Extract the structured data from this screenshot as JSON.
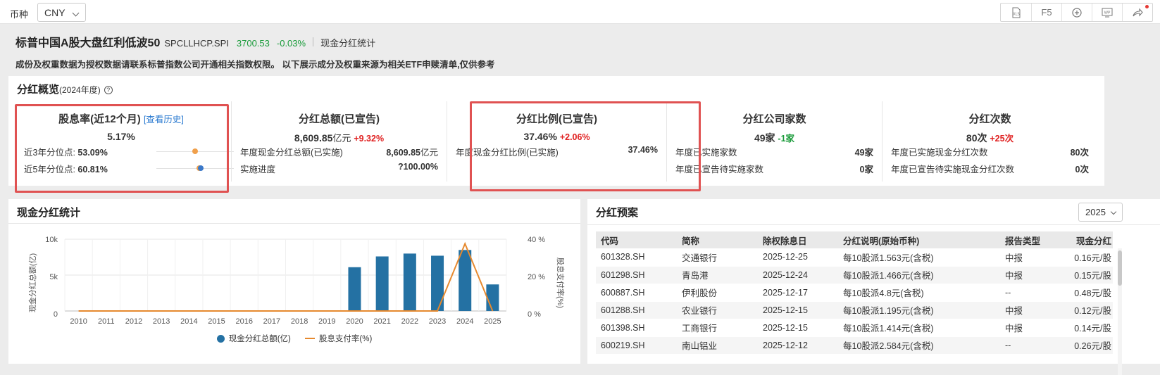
{
  "toolbar": {
    "currency_label": "币种",
    "currency_value": "CNY",
    "buttons": [
      {
        "icon": "xls-export-icon",
        "label": "XLS"
      },
      {
        "icon": "f5-refresh",
        "label": "F5"
      },
      {
        "icon": "add-circle-icon",
        "label": "⊕"
      },
      {
        "icon": "wp-export-icon",
        "label": "WP"
      },
      {
        "icon": "share-icon",
        "label": "↪"
      }
    ],
    "notification_color": "#e53935"
  },
  "header": {
    "index_name": "标普中国A股大盘红利低波50",
    "index_code": "SPCLLHCP.SPI",
    "price": "3700.53",
    "change": "-0.03%",
    "tab": "现金分红统计",
    "notice": "成份及权重数据为授权数据请联系标普指数公司开通相关指数权限。 以下展示成分及权重来源为相关ETF申赎清单,仅供参考"
  },
  "overview": {
    "title": "分红概览",
    "period": "(2024年度)",
    "yield": {
      "title": "股息率(近12个月)",
      "history_link": "[查看历史]",
      "value": "5.17%",
      "p3_label": "近3年分位点:",
      "p3_value": "53.09%",
      "p3_fraction": 0.5309,
      "p5_label": "近5年分位点:",
      "p5_value": "60.81%",
      "p5_fraction": 0.6081,
      "dot_colors": [
        "#f0a04b",
        "#3a78c9"
      ]
    },
    "total": {
      "title": "分红总额(已宣告)",
      "value": "8,609.85",
      "unit": "亿元",
      "change": "+9.32%",
      "row1_label": "年度现金分红总额(已实施)",
      "row1_value": "8,609.85",
      "row1_unit": "亿元",
      "row2_label": "实施进度",
      "row2_value": "?100.00%"
    },
    "ratio": {
      "title": "分红比例(已宣告)",
      "value": "37.46%",
      "change": "+2.06%",
      "row1_label": "年度现金分红比例(已实施)",
      "row1_value": "37.46%"
    },
    "companies": {
      "title": "分红公司家数",
      "value": "49家",
      "change": "-1家",
      "row1_label": "年度已实施家数",
      "row1_value": "49家",
      "row2_label": "年度已宣告待实施家数",
      "row2_value": "0家"
    },
    "times": {
      "title": "分红次数",
      "value": "80次",
      "change": "+25次",
      "row1_label": "年度已实施现金分红次数",
      "row1_value": "80次",
      "row2_label": "年度已宣告待实施现金分红次数",
      "row2_value": "0次"
    }
  },
  "cash_chart": {
    "title": "现金分红统计",
    "left_axis_label": "现金分红总额(亿)",
    "right_axis_label": "股息支付率(%)",
    "left_ticks": [
      "10k",
      "5k",
      "0"
    ],
    "right_ticks": [
      "40 %",
      "20 %",
      "0 %"
    ],
    "legend_bar": "现金分红总额(亿)",
    "legend_line": "股息支付率(%)",
    "bar_color": "#2471a3",
    "line_color": "#e6892e"
  },
  "chart_data": {
    "type": "bar",
    "categories": [
      "2010",
      "2011",
      "2012",
      "2013",
      "2014",
      "2015",
      "2016",
      "2017",
      "2018",
      "2019",
      "2020",
      "2021",
      "2022",
      "2023",
      "2024",
      "2025"
    ],
    "series": [
      {
        "name": "现金分红总额(亿)",
        "type": "bar",
        "axis": "left",
        "values": [
          0,
          0,
          0,
          0,
          0,
          0,
          0,
          0,
          0,
          0,
          6100,
          7600,
          8000,
          7700,
          8500,
          3700
        ]
      },
      {
        "name": "股息支付率(%)",
        "type": "line",
        "axis": "right",
        "values": [
          0,
          0,
          0,
          0,
          0,
          0,
          0,
          0,
          0,
          0,
          0,
          0,
          0,
          0,
          37.5,
          0
        ]
      }
    ],
    "ylim_left": [
      0,
      10000
    ],
    "ylim_right": [
      0,
      40
    ],
    "grid": true,
    "legend_position": "bottom"
  },
  "plan": {
    "title": "分红预案",
    "year_select": "2025",
    "columns": [
      "代码",
      "简称",
      "除权除息日",
      "分红说明(原始币种)",
      "报告类型",
      "现金分红"
    ],
    "rows": [
      [
        "601328.SH",
        "交通银行",
        "2025-12-25",
        "每10股派1.563元(含税)",
        "中报",
        "0.16元/股"
      ],
      [
        "601298.SH",
        "青岛港",
        "2025-12-24",
        "每10股派1.466元(含税)",
        "中报",
        "0.15元/股"
      ],
      [
        "600887.SH",
        "伊利股份",
        "2025-12-17",
        "每10股派4.8元(含税)",
        "--",
        "0.48元/股"
      ],
      [
        "601288.SH",
        "农业银行",
        "2025-12-15",
        "每10股派1.195元(含税)",
        "中报",
        "0.12元/股"
      ],
      [
        "601398.SH",
        "工商银行",
        "2025-12-15",
        "每10股派1.414元(含税)",
        "中报",
        "0.14元/股"
      ],
      [
        "600219.SH",
        "南山铝业",
        "2025-12-12",
        "每10股派2.584元(含税)",
        "--",
        "0.26元/股"
      ]
    ]
  }
}
